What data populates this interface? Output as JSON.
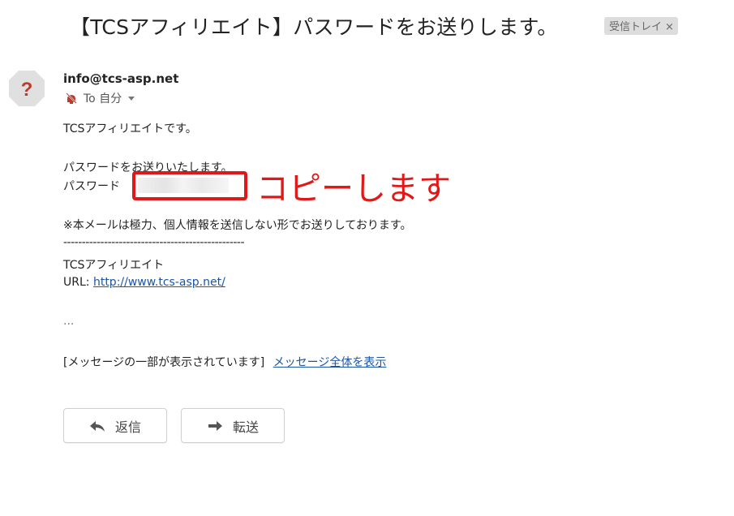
{
  "email": {
    "subject": "【TCSアフィリエイト】パスワードをお送りします。",
    "label_chip": "受信トレイ",
    "label_close": "×",
    "sender": "info@tcs-asp.net",
    "recipient": "To 自分",
    "body": {
      "greeting": "TCSアフィリエイトです。",
      "line_send": "パスワードをお送りいたします。",
      "password_label": "パスワード",
      "notice": "※本メールは極力、個人情報を送信しない形でお送りしております。",
      "separator": "-------------------------------------------------",
      "signature_name": "TCSアフィリエイト",
      "url_label": "URL:",
      "url": "http://www.tcs-asp.net/",
      "ellipsis": "...",
      "clipped_notice": "[メッセージの一部が表示されています]",
      "show_full_link": "メッセージ全体を表示"
    }
  },
  "annotation": {
    "text": "コピーします",
    "color": "#e21818"
  },
  "actions": {
    "reply_label": "返信",
    "forward_label": "転送"
  },
  "icons": {
    "avatar": "unknown-sender-question-icon",
    "recipient": "mute-icon",
    "recipient_caret": "chevron-down-icon",
    "reply": "reply-arrow-icon",
    "forward": "forward-arrow-icon"
  },
  "colors": {
    "link": "#1a55a8",
    "annotation_red": "#e21818",
    "avatar_bg": "#e0e0e0",
    "avatar_mark": "#c0392b"
  }
}
